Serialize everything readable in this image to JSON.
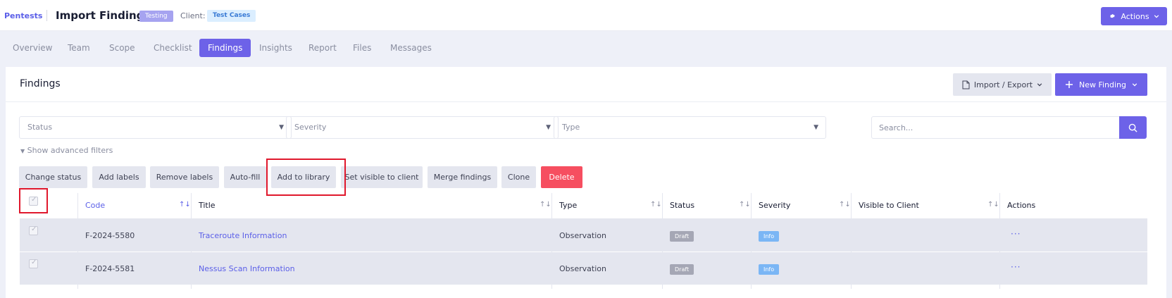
{
  "header": {
    "breadcrumb": "Pentests",
    "title": "Import Findings",
    "status_badge": "Testing",
    "client_label": "Client:",
    "client_name": "Test Cases",
    "actions_label": "Actions"
  },
  "tabs": [
    "Overview",
    "Team",
    "Scope",
    "Checklist",
    "Findings",
    "Insights",
    "Report",
    "Files",
    "Messages"
  ],
  "active_tab": "Findings",
  "card": {
    "title": "Findings",
    "import_export_label": "Import / Export",
    "new_finding_label": "New Finding"
  },
  "filters": {
    "status_placeholder": "Status",
    "severity_placeholder": "Severity",
    "type_placeholder": "Type",
    "search_placeholder": "Search...",
    "advanced_label": "Show advanced filters"
  },
  "bulk_actions": [
    "Change status",
    "Add labels",
    "Remove labels",
    "Auto-fill",
    "Add to library",
    "Set visible to client",
    "Merge findings",
    "Clone",
    "Delete"
  ],
  "table": {
    "columns": [
      "Code",
      "Title",
      "Type",
      "Status",
      "Severity",
      "Visible to Client",
      "Actions"
    ],
    "rows": [
      {
        "code": "F-2024-5580",
        "title": "Traceroute Information",
        "type": "Observation",
        "status": "Draft",
        "severity": "Info",
        "visible": "",
        "actions": "···"
      },
      {
        "code": "F-2024-5581",
        "title": "Nessus Scan Information",
        "type": "Observation",
        "status": "Draft",
        "severity": "Info",
        "visible": "",
        "actions": "···"
      }
    ]
  },
  "colors": {
    "primary": "#6d62e8",
    "danger": "#f64e60",
    "highlight": "#e0182d",
    "info": "#7bb6f5",
    "draft": "#a5a7b5"
  },
  "icons": {
    "actions": "gear-icon",
    "import_export": "document-icon",
    "new_finding": "plus-icon",
    "search": "search-icon",
    "select": "chevron-down-icon"
  }
}
